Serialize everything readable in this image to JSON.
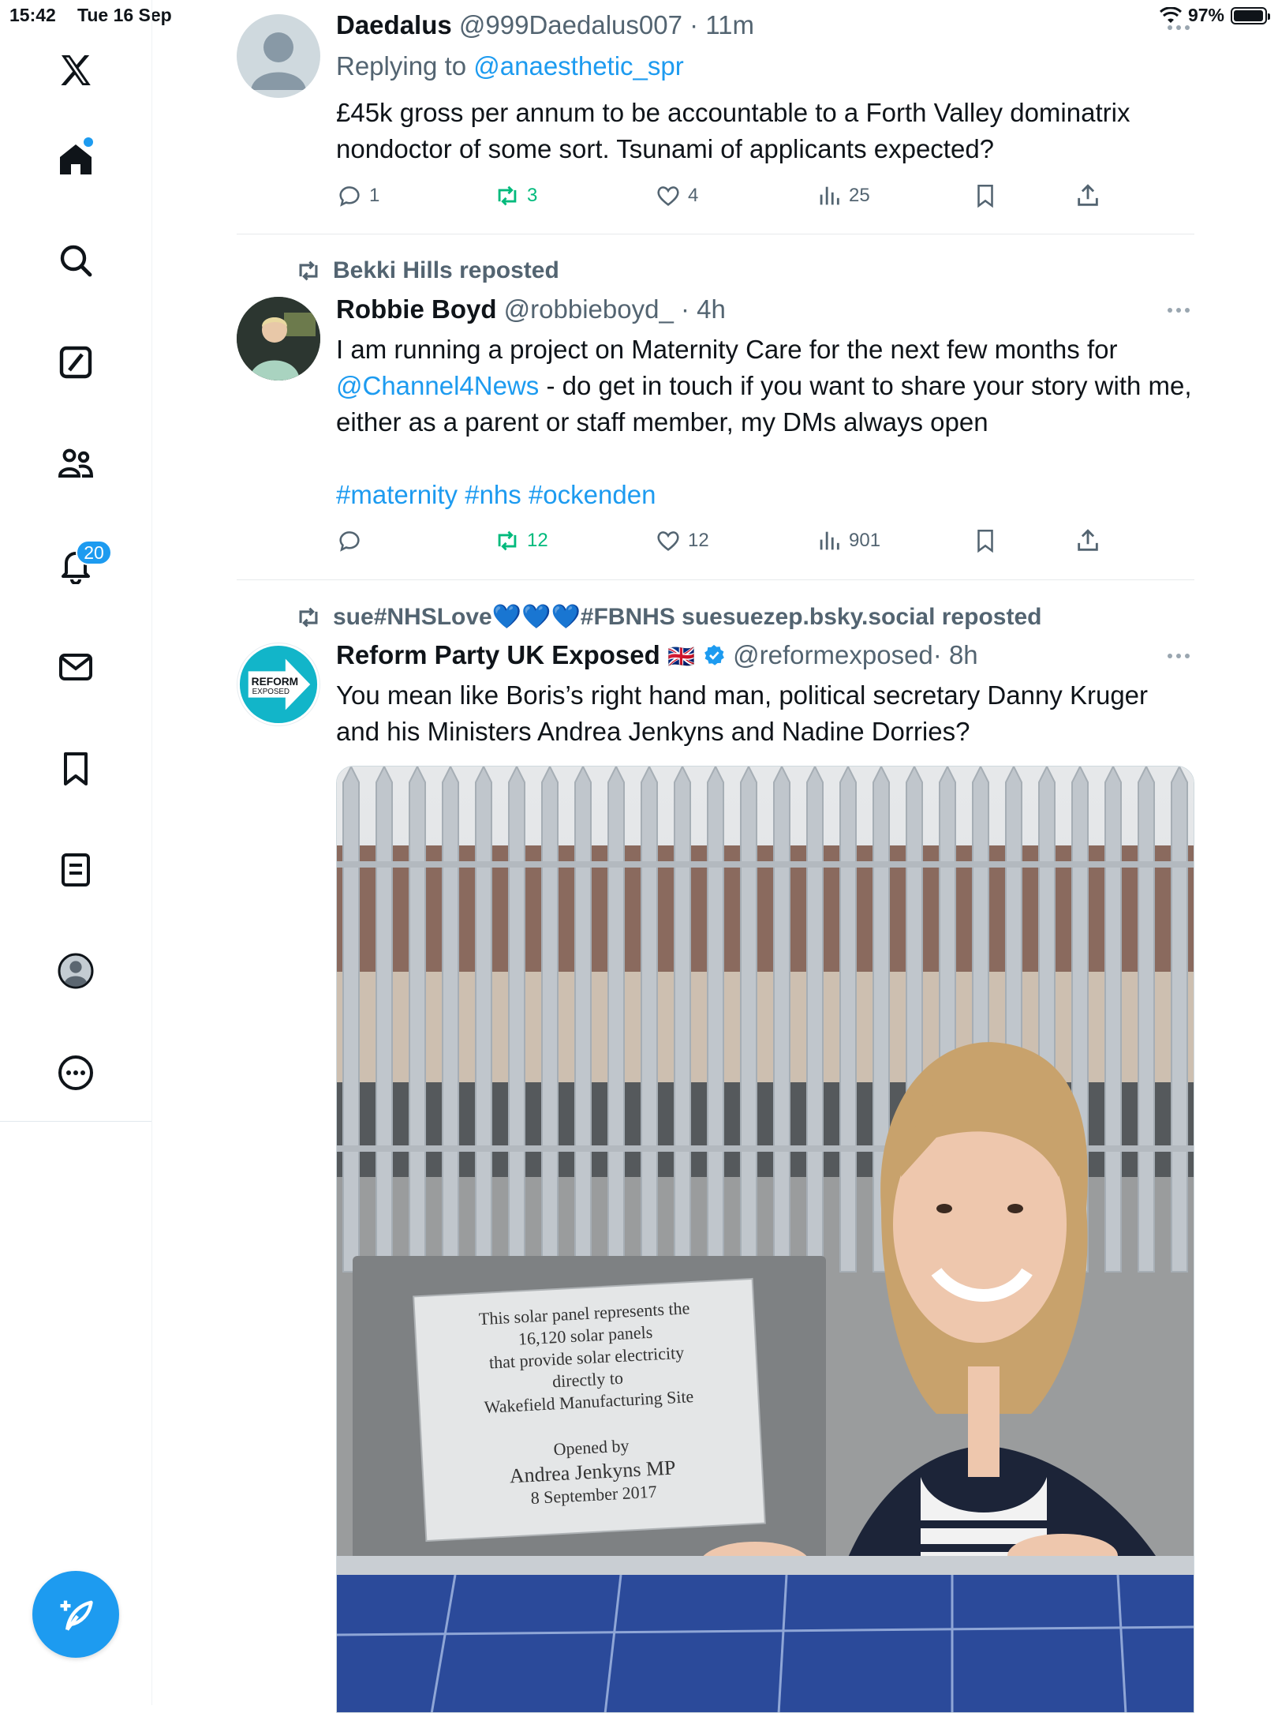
{
  "status_bar": {
    "time": "15:42",
    "date": "Tue 16 Sep",
    "battery": "97%",
    "battery_level": 0.97
  },
  "sidebar": {
    "items": [
      {
        "name": "x-logo-icon",
        "label": "X"
      },
      {
        "name": "home-icon",
        "label": "Home"
      },
      {
        "name": "search-icon",
        "label": "Search"
      },
      {
        "name": "grok-icon",
        "label": "Grok"
      },
      {
        "name": "communities-icon",
        "label": "Communities"
      },
      {
        "name": "notifications-icon",
        "label": "Notifications"
      },
      {
        "name": "messages-icon",
        "label": "Messages"
      },
      {
        "name": "bookmarks-icon",
        "label": "Bookmarks"
      },
      {
        "name": "lists-icon",
        "label": "Lists"
      },
      {
        "name": "profile-icon",
        "label": "Profile"
      },
      {
        "name": "more-icon",
        "label": "More"
      }
    ],
    "notifications_badge": "20",
    "compose_label": "Post"
  },
  "posts": [
    {
      "name": "Daedalus",
      "handle": "@999Daedalus007",
      "time": "· 11m",
      "reply_prefix": "Replying to ",
      "reply_to": "@anaesthetic_spr",
      "text": "£45k gross per annum to be accountable to a Forth Valley dominatrix nondoctor of some sort. Tsunami of applicants expected?",
      "replies": "1",
      "reposts": "3",
      "likes": "4",
      "views": "25"
    },
    {
      "reposted_by": "Bekki Hills reposted",
      "name": "Robbie Boyd",
      "handle": "@robbieboyd_",
      "time": "· 4h",
      "text_1": "I am running a project on Maternity Care for the next few months for ",
      "mention": "@Channel4News",
      "text_2": " - do get in touch if you want to share your story with me, either as a parent or staff member, my DMs always open",
      "hashtags": "#maternity #nhs #ockenden",
      "replies": "",
      "reposts": "12",
      "likes": "12",
      "views": "901"
    },
    {
      "reposted_by": "sue#NHSLove💙💙💙#FBNHS suesuezep.bsky.social reposted",
      "name": "Reform Party UK Exposed",
      "flag": "🇬🇧",
      "handle": "@reformexposed",
      "time": "· 8h",
      "text": "You mean like Boris’s right hand man, political secretary Danny Kruger and his Ministers Andrea Jenkyns and Nadine Dorries?",
      "avatar_text_1": "REFORM",
      "avatar_text_2": "EXPOSED",
      "image": {
        "plaque_lines": [
          "This solar panel represents the",
          "16,120 solar panels",
          "that provide solar electricity",
          "directly to",
          "Wakefield Manufacturing Site",
          "",
          "Opened by",
          "Andrea Jenkyns MP",
          "8 September 2017"
        ]
      }
    }
  ]
}
